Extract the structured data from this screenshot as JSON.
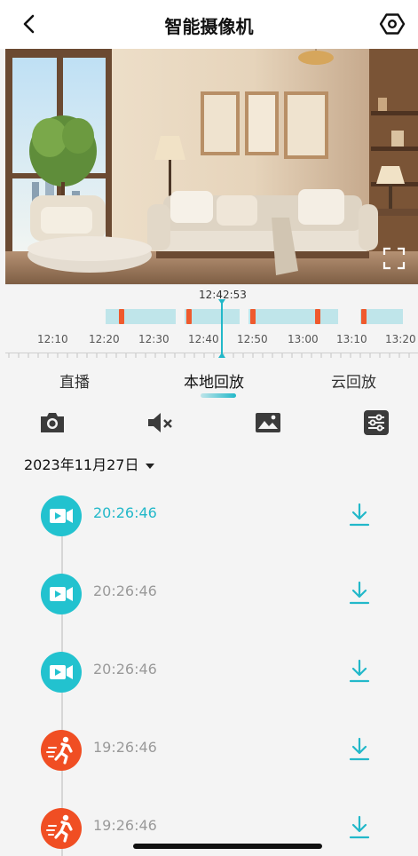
{
  "header": {
    "back_icon": "chevron-left-icon",
    "title": "智能摄像机",
    "settings_icon": "hexagon-settings-icon"
  },
  "video": {
    "fullscreen_icon": "fullscreen-icon"
  },
  "timeline": {
    "current_time": "12:42:53",
    "ticks": [
      "12:10",
      "12:20",
      "12:30",
      "12:40",
      "12:50",
      "13:00",
      "13:10",
      "13:20"
    ],
    "record_color": "#bfe5ea",
    "event_color": "#ef5a2d",
    "cursor_color": "#22b8c9"
  },
  "tabs": [
    {
      "label": "直播"
    },
    {
      "label": "本地回放",
      "active": true
    },
    {
      "label": "云回放"
    }
  ],
  "toolbar": {
    "icons": [
      "camera-icon",
      "mute-icon",
      "image-icon",
      "sliders-icon"
    ]
  },
  "date": {
    "label": "2023年11月27日"
  },
  "recordings": [
    {
      "time": "20:26:46",
      "type": "video",
      "active": true
    },
    {
      "time": "20:26:46",
      "type": "video",
      "active": false
    },
    {
      "time": "20:26:46",
      "type": "video",
      "active": false
    },
    {
      "time": "19:26:46",
      "type": "motion",
      "active": false
    },
    {
      "time": "19:26:46",
      "type": "motion",
      "active": false
    }
  ],
  "colors": {
    "accent": "#22b8c9",
    "video_badge": "#22c2cf",
    "motion_badge": "#f04e23"
  }
}
